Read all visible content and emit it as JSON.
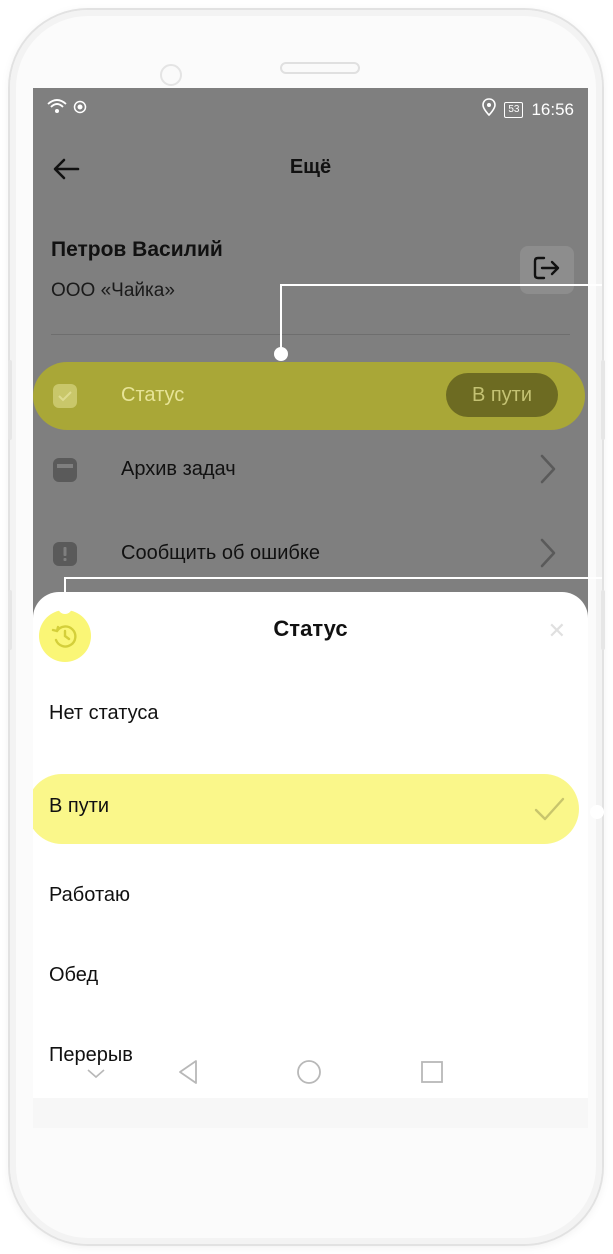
{
  "status_bar": {
    "time": "16:56",
    "battery": "53"
  },
  "header": {
    "title": "Ещё"
  },
  "profile": {
    "name": "Петров Василий",
    "organization": "ООО «Чайка»"
  },
  "menu": {
    "status_label": "Статус",
    "status_value": "В пути",
    "archive_label": "Архив задач",
    "report_label": "Сообщить об ошибке"
  },
  "sheet": {
    "title": "Статус",
    "options": [
      "Нет статуса",
      "В пути",
      "Работаю",
      "Обед",
      "Перерыв"
    ],
    "selected": "В пути"
  },
  "colors": {
    "highlight": "#faf78a",
    "overlay": "#7f7f7f"
  }
}
